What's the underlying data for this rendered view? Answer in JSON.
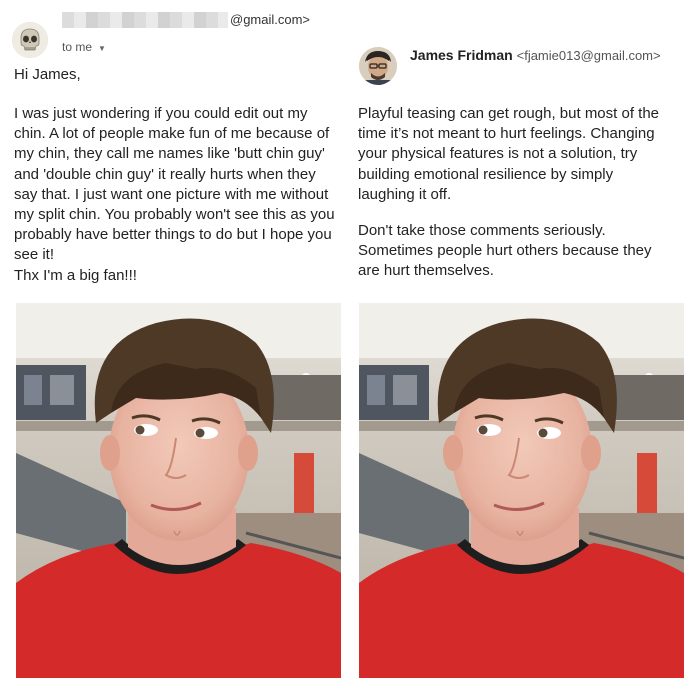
{
  "left_email": {
    "sender_email": "@gmail.com>",
    "to_label": "to me",
    "greeting": "Hi James,",
    "body_lines": [
      "I was just wondering if you could edit out my",
      "chin. A lot of people make fun of me because of",
      "my chin, they call me names like 'butt chin guy'",
      "and 'double chin guy' it really hurts when they",
      "say that. I just want one picture with me without",
      "my split chin. You probably won't see this as you",
      "probably have better things to do but I hope you",
      "see it!"
    ],
    "signoff": "Thx I'm a big fan!!!"
  },
  "right_email": {
    "sender_name": "James Fridman",
    "sender_email": "<fjamie013@gmail.com>",
    "paragraph1_lines": [
      "Playful teasing can get rough, but most of the",
      "time it’s not meant to hurt feelings. Changing",
      "your physical features is not a solution, try",
      "building emotional resilience by simply",
      "laughing it off."
    ],
    "paragraph2_lines": [
      "Don't take those comments seriously.",
      "Sometimes people hurt others because they",
      "are hurt themselves."
    ]
  },
  "icons": {
    "left_avatar": "skull-avatar-icon",
    "right_avatar": "person-avatar-icon",
    "dropdown": "caret-down-icon"
  },
  "colors": {
    "shirt_red": "#d42a2a",
    "hair_brown": "#4e3826",
    "mall_background": "#cfc9bf"
  }
}
